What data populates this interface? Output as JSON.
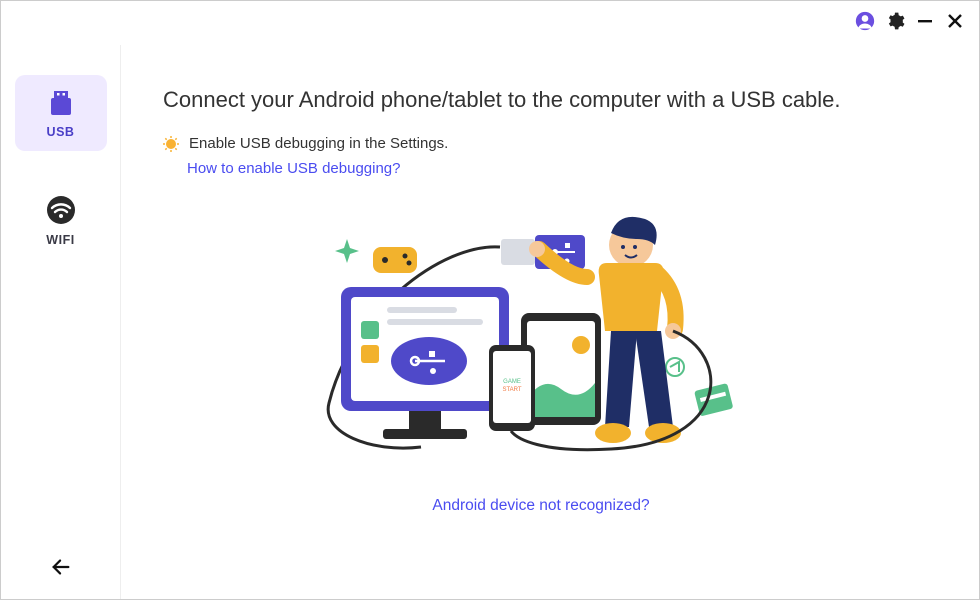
{
  "titlebar": {
    "account_icon": "account-icon",
    "settings_icon": "gear-icon",
    "minimize_icon": "minimize-icon",
    "close_icon": "close-icon"
  },
  "sidebar": {
    "items": [
      {
        "key": "usb",
        "label": "USB",
        "icon": "usb-icon",
        "active": true
      },
      {
        "key": "wifi",
        "label": "WIFI",
        "icon": "wifi-icon",
        "active": false
      }
    ],
    "back_icon": "arrow-left-icon"
  },
  "main": {
    "heading": "Connect your Android phone/tablet to the computer with a USB cable.",
    "tip_icon": "lightbulb-icon",
    "tip_text": "Enable USB debugging in the Settings.",
    "help_link": "How to enable USB debugging?",
    "footer_link": "Android device not recognized?"
  },
  "colors": {
    "accent": "#5a4fe0",
    "link": "#4a4cf0",
    "active_bg": "#efeaff"
  }
}
